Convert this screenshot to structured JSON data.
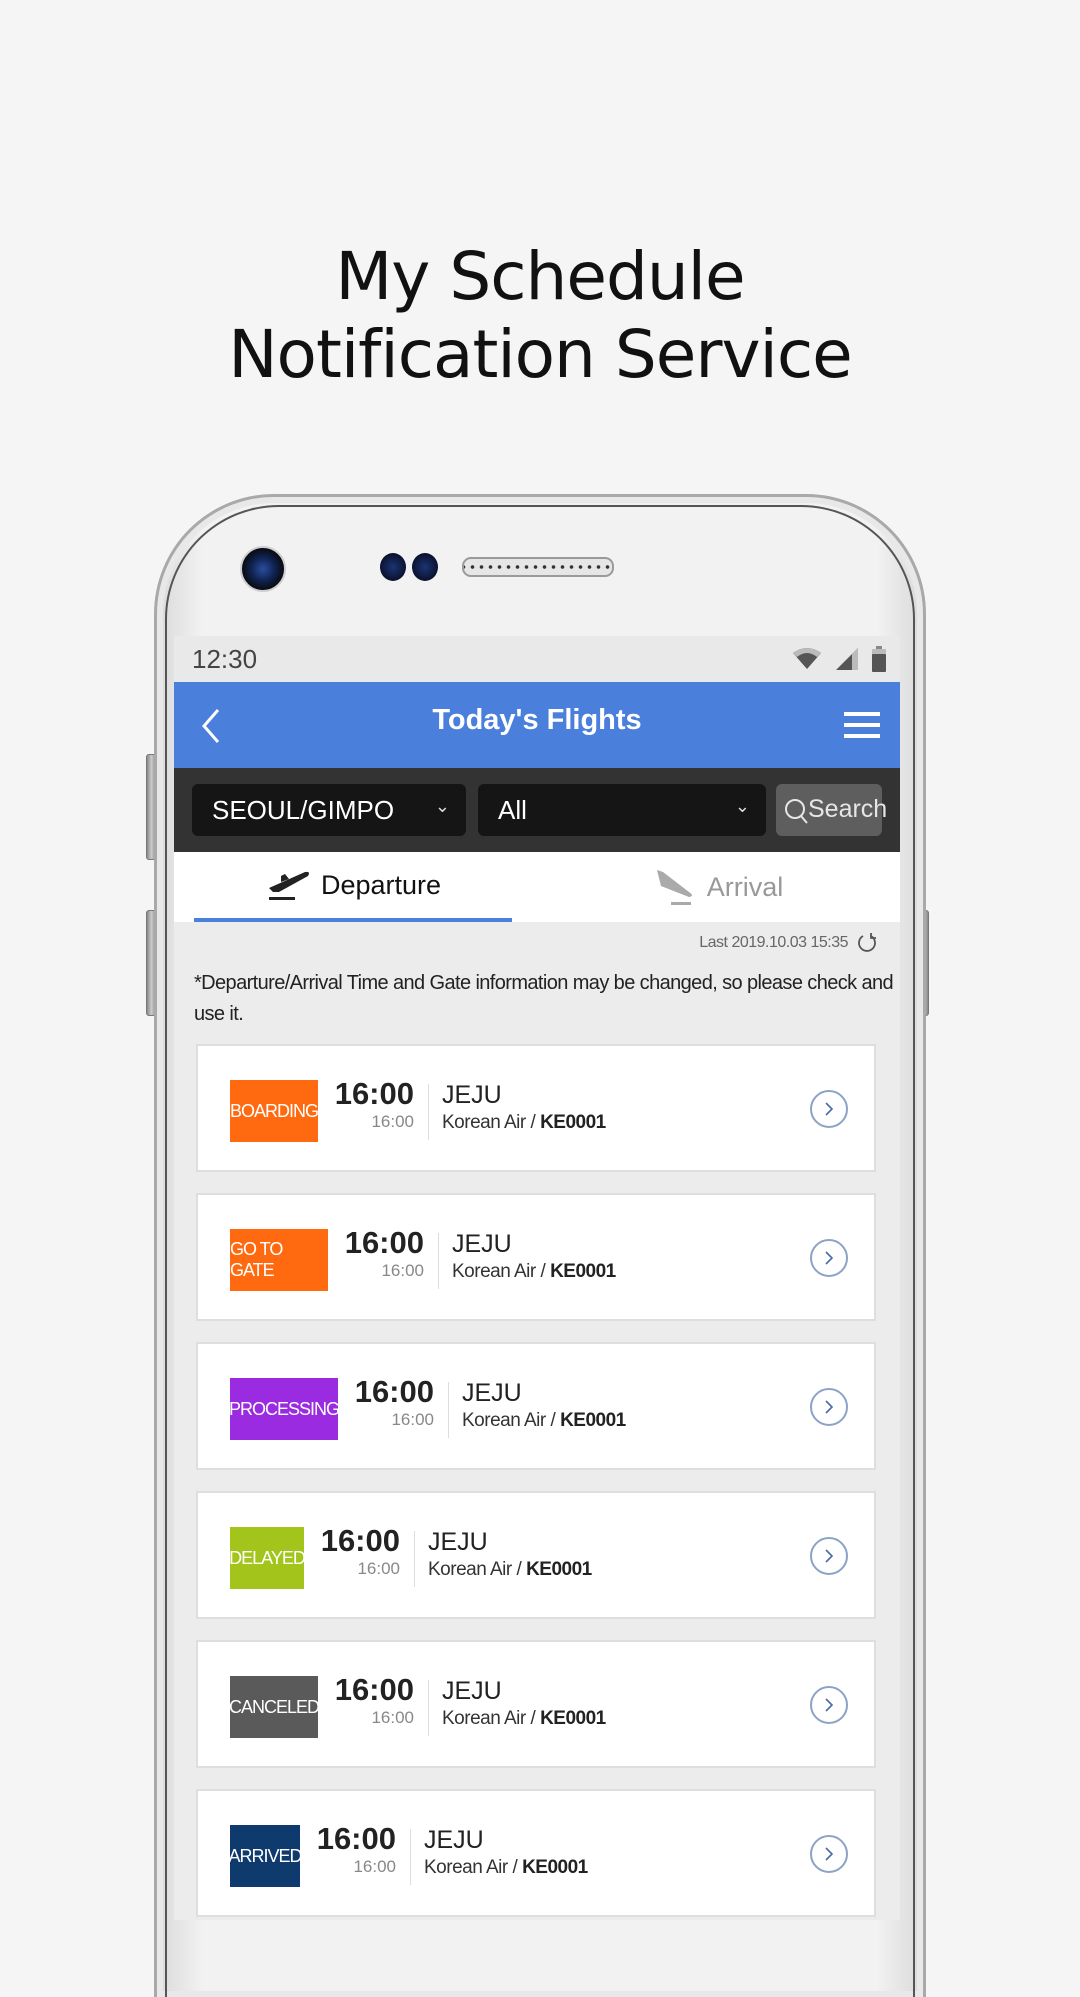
{
  "headline": {
    "line1": "My Schedule",
    "line2": "Notification Service"
  },
  "status_bar": {
    "time": "12:30",
    "icons": [
      "wifi-icon",
      "signal-icon",
      "battery-icon"
    ]
  },
  "app_bar": {
    "title": "Today's Flights",
    "back_icon": "chevron-left-icon",
    "menu_icon": "hamburger-menu-icon"
  },
  "filters": {
    "airport": {
      "value": "SEOUL/GIMPO"
    },
    "type": {
      "value": "All"
    },
    "search_label": "Search"
  },
  "tabs": [
    {
      "label": "Departure",
      "icon": "plane-takeoff-icon",
      "active": true
    },
    {
      "label": "Arrival",
      "icon": "plane-landing-icon",
      "active": false
    }
  ],
  "last_updated": "Last 2019.10.03 15:35",
  "notice": "*Departure/Arrival Time and Gate information may be changed, so please check and use it.",
  "flights": [
    {
      "status": "BOARDING",
      "status_color": "#ff6a10",
      "scheduled": "16:00",
      "actual": "16:00",
      "destination": "JEJU",
      "airline": "Korean Air /",
      "flight_no": "KE0001"
    },
    {
      "status": "GO TO GATE",
      "status_color": "#ff6a10",
      "scheduled": "16:00",
      "actual": "16:00",
      "destination": "JEJU",
      "airline": "Korean Air /",
      "flight_no": "KE0001"
    },
    {
      "status": "PROCESSING",
      "status_color": "#9b2be0",
      "scheduled": "16:00",
      "actual": "16:00",
      "destination": "JEJU",
      "airline": "Korean Air /",
      "flight_no": "KE0001"
    },
    {
      "status": "DELAYED",
      "status_color": "#a3c41a",
      "scheduled": "16:00",
      "actual": "16:00",
      "destination": "JEJU",
      "airline": "Korean Air /",
      "flight_no": "KE0001"
    },
    {
      "status": "CANCELED",
      "status_color": "#5a5a5a",
      "scheduled": "16:00",
      "actual": "16:00",
      "destination": "JEJU",
      "airline": "Korean Air /",
      "flight_no": "KE0001"
    },
    {
      "status": "ARRIVED",
      "status_color": "#0f3a6e",
      "scheduled": "16:00",
      "actual": "16:00",
      "destination": "JEJU",
      "airline": "Korean Air /",
      "flight_no": "KE0001"
    }
  ],
  "colors": {
    "accent": "#4a7fdb",
    "filter_bar": "#333333"
  }
}
